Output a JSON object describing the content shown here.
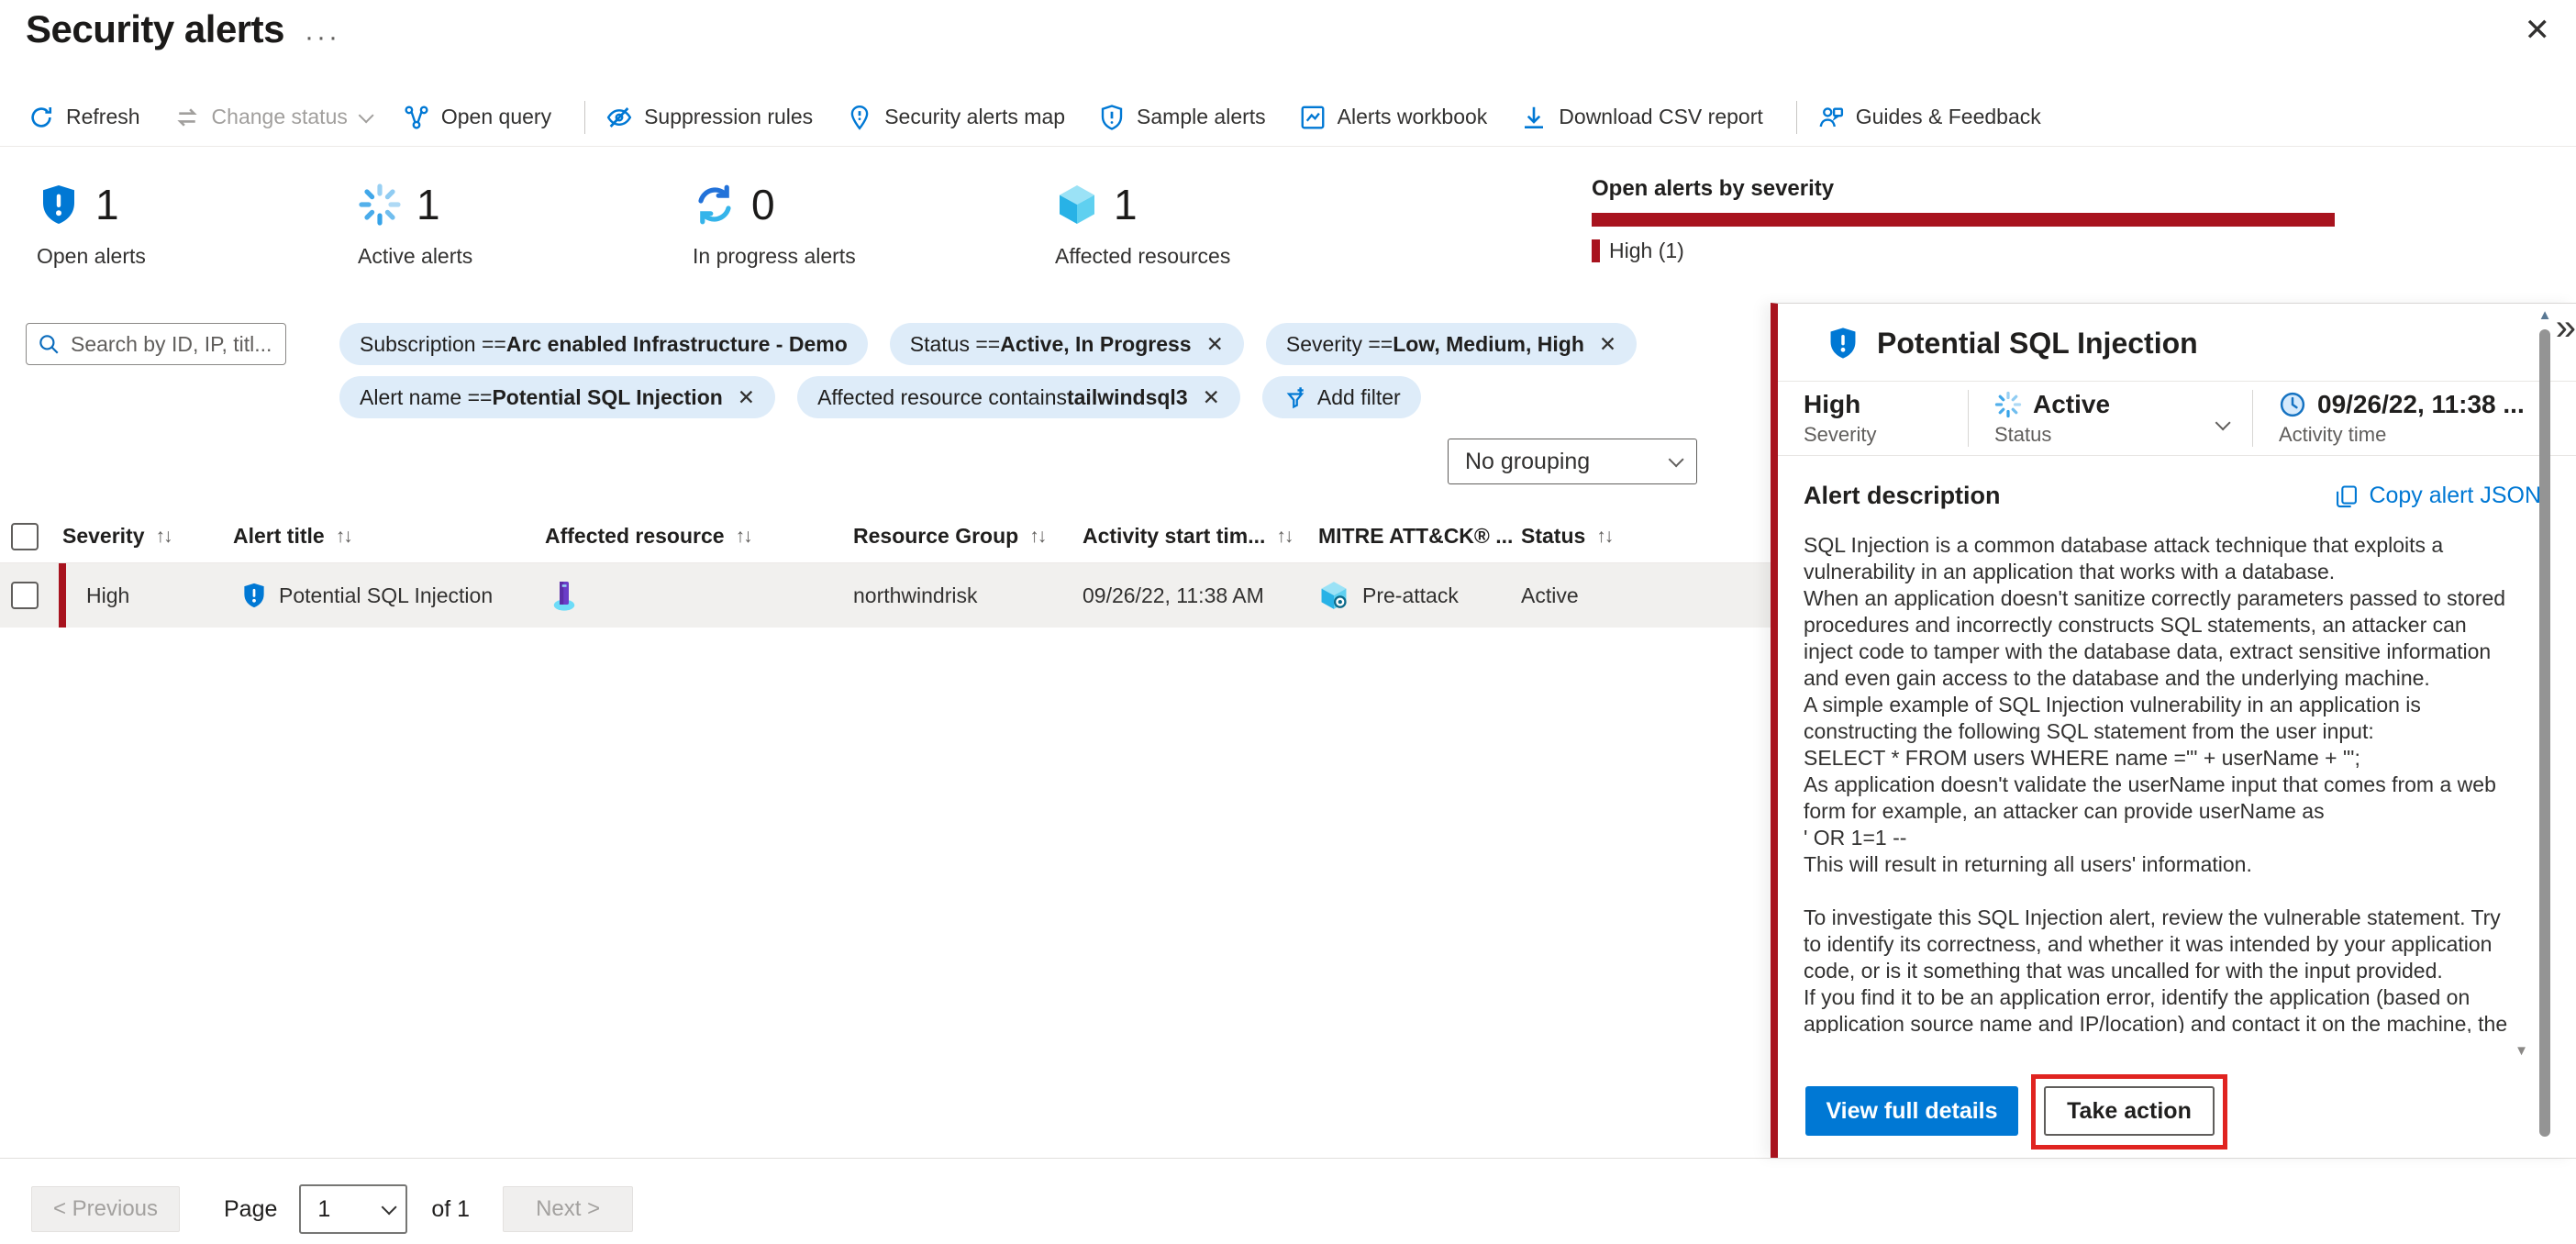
{
  "page": {
    "title": "Security alerts"
  },
  "icons": {
    "close": "✕",
    "ellipsis": "···",
    "collapse": "»",
    "sort": "↑↓",
    "scroll_up": "▲",
    "scroll_down": "▼"
  },
  "toolbar": {
    "items": [
      {
        "label": "Refresh"
      },
      {
        "label": "Change status"
      },
      {
        "label": "Open query"
      },
      {
        "label": "Suppression rules"
      },
      {
        "label": "Security alerts map"
      },
      {
        "label": "Sample alerts"
      },
      {
        "label": "Alerts workbook"
      },
      {
        "label": "Download CSV report"
      },
      {
        "label": "Guides & Feedback"
      }
    ]
  },
  "stats": [
    {
      "value": "1",
      "label": "Open alerts"
    },
    {
      "value": "1",
      "label": "Active alerts"
    },
    {
      "value": "0",
      "label": "In progress alerts"
    },
    {
      "value": "1",
      "label": "Affected resources"
    }
  ],
  "severity_chart": {
    "title": "Open alerts by severity",
    "legend": "High (1)",
    "bar_color": "#a8131e",
    "high_count": 1
  },
  "filters": {
    "search_placeholder": "Search by ID, IP, titl...",
    "pills": [
      {
        "prefix": "Subscription == ",
        "value": "Arc enabled Infrastructure - Demo"
      },
      {
        "prefix": "Status == ",
        "value": "Active, In Progress",
        "dismiss": "✕"
      },
      {
        "prefix": "Severity == ",
        "value": "Low, Medium, High",
        "dismiss": "✕"
      },
      {
        "prefix": "Alert name == ",
        "value": "Potential SQL Injection",
        "dismiss": "✕"
      },
      {
        "prefix": "Affected resource contains ",
        "value": "tailwindsql3",
        "dismiss": "✕"
      }
    ],
    "add_filter": "Add filter"
  },
  "grouping": {
    "value": "No grouping"
  },
  "table": {
    "columns": [
      "Severity",
      "Alert title",
      "Affected resource",
      "Resource Group",
      "Activity start tim...",
      "MITRE ATT&CK® ...",
      "Status"
    ],
    "rows": [
      {
        "severity": "High",
        "alert_title": "Potential SQL Injection",
        "resource_group": "northwindrisk",
        "activity_start": "09/26/22, 11:38 AM",
        "mitre": "Pre-attack",
        "status": "Active"
      }
    ]
  },
  "pagination": {
    "previous": "< Previous",
    "page_label": "Page",
    "page_value": "1",
    "of_label": "of 1",
    "next": "Next >"
  },
  "panel": {
    "title": "Potential SQL Injection",
    "severity_value": "High",
    "severity_label": "Severity",
    "status_value": "Active",
    "status_label": "Status",
    "time_value": "09/26/22, 11:38 ...",
    "time_label": "Activity time",
    "description_heading": "Alert description",
    "copy_json": "Copy alert JSON",
    "description": "SQL Injection is a common database attack technique that exploits a vulnerability in an application that works with a database.\nWhen an application doesn't sanitize correctly parameters passed to stored procedures and incorrectly constructs SQL statements, an attacker can inject code to tamper with the database data, extract sensitive information and even gain access to the database and the underlying machine.\nA simple example of SQL Injection vulnerability in an application is constructing the following SQL statement from the user input:\nSELECT * FROM users WHERE name ='\" + userName + \"';\nAs application doesn't validate the userName input that comes from a web form for example, an attacker can provide userName as\n' OR 1=1 --\nThis will result in returning all users' information.\n\nTo investigate this SQL Injection alert, review the vulnerable statement. Try to identify its correctness, and whether it was intended by your application code, or is it something that was uncalled for with the input provided.\nIf you find it to be an application error, identify the application (based on application source name and IP/location) and contact it on the machine, the set of fi",
    "view_full_details": "View full details",
    "take_action": "Take action"
  }
}
